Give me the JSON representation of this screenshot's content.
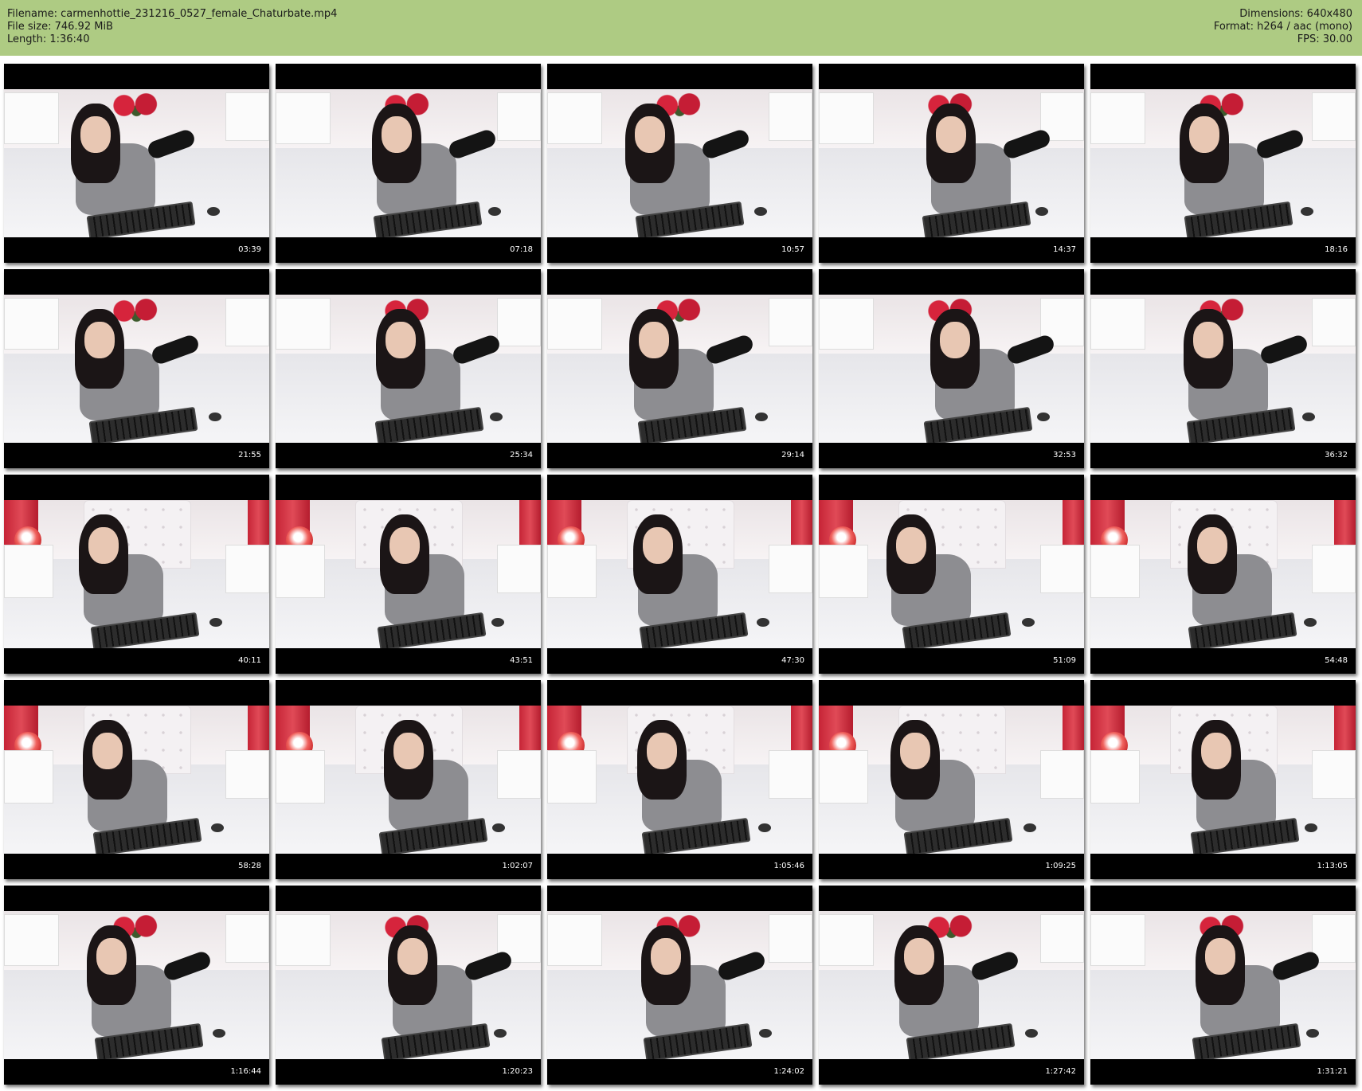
{
  "header": {
    "filename_line": "Filename: carmenhottie_231216_0527_female_Chaturbate.mp4",
    "filesize_line": "File size: 746.92 MiB",
    "length_line": "Length: 1:36:40",
    "dimensions_line": "Dimensions: 640x480",
    "format_line": "Format: h264 / aac (mono)",
    "fps_line": "FPS: 30.00"
  },
  "colors": {
    "header_bg": "#aecb83",
    "frame_bg": "#000000"
  },
  "thumbnails": [
    {
      "timestamp": "03:39",
      "scene": "bed"
    },
    {
      "timestamp": "07:18",
      "scene": "bed"
    },
    {
      "timestamp": "10:57",
      "scene": "bed"
    },
    {
      "timestamp": "14:37",
      "scene": "bed"
    },
    {
      "timestamp": "18:16",
      "scene": "bed"
    },
    {
      "timestamp": "21:55",
      "scene": "bed"
    },
    {
      "timestamp": "25:34",
      "scene": "bed"
    },
    {
      "timestamp": "29:14",
      "scene": "bed"
    },
    {
      "timestamp": "32:53",
      "scene": "bed"
    },
    {
      "timestamp": "36:32",
      "scene": "bed"
    },
    {
      "timestamp": "40:11",
      "scene": "red"
    },
    {
      "timestamp": "43:51",
      "scene": "red"
    },
    {
      "timestamp": "47:30",
      "scene": "red"
    },
    {
      "timestamp": "51:09",
      "scene": "red"
    },
    {
      "timestamp": "54:48",
      "scene": "red"
    },
    {
      "timestamp": "58:28",
      "scene": "red"
    },
    {
      "timestamp": "1:02:07",
      "scene": "red"
    },
    {
      "timestamp": "1:05:46",
      "scene": "red"
    },
    {
      "timestamp": "1:09:25",
      "scene": "red"
    },
    {
      "timestamp": "1:13:05",
      "scene": "red"
    },
    {
      "timestamp": "1:16:44",
      "scene": "bed"
    },
    {
      "timestamp": "1:20:23",
      "scene": "bed"
    },
    {
      "timestamp": "1:24:02",
      "scene": "bed"
    },
    {
      "timestamp": "1:27:42",
      "scene": "bed"
    },
    {
      "timestamp": "1:31:21",
      "scene": "bed"
    }
  ]
}
